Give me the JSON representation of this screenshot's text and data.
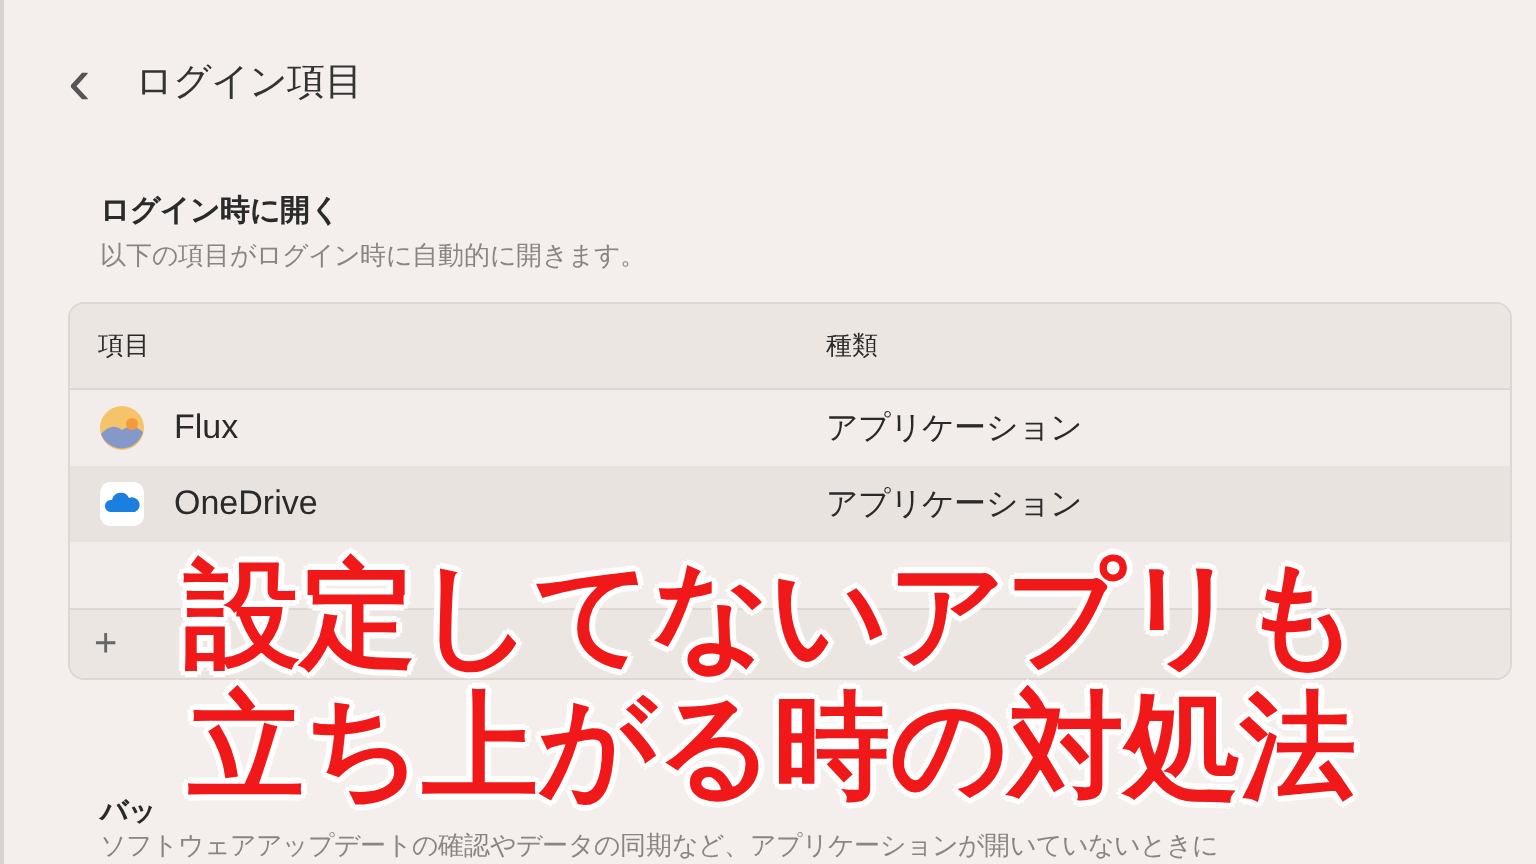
{
  "header": {
    "back": "‹",
    "title": "ログイン項目"
  },
  "login_section": {
    "heading": "ログイン時に開く",
    "description": "以下の項目がログイン時に自動的に開きます。"
  },
  "table": {
    "columns": [
      "項目",
      "種類"
    ],
    "rows": [
      {
        "kind": "sunset",
        "name": "Flux",
        "type": "アプリケーション"
      },
      {
        "kind": "cloud",
        "name": "OneDrive",
        "type": "アプリケーション"
      }
    ],
    "add": "+"
  },
  "caption": [
    "設定してないアプリも",
    "立ち上がる時の対処法"
  ],
  "background_section": {
    "heading": "バッ",
    "description": "ソフトウェアアップデートの確認やデータの同期など、アプリケーションが開いていないときに"
  }
}
